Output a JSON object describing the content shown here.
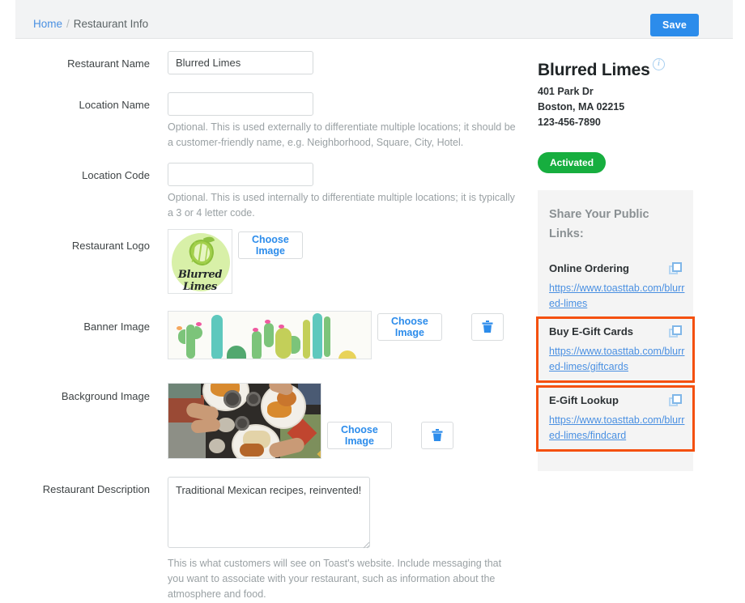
{
  "header": {
    "breadcrumb_home": "Home",
    "breadcrumb_sep": "/",
    "breadcrumb_current": "Restaurant Info",
    "save_label": "Save",
    "accent_blue": "#2c8ceb",
    "bar_bg": "#f2f3f4"
  },
  "form": {
    "restaurant_name": {
      "label": "Restaurant Name",
      "value": "Blurred Limes",
      "placeholder": ""
    },
    "location_name": {
      "label": "Location Name",
      "value": "",
      "placeholder": "",
      "helper": "Optional. This is used externally to differentiate multiple locations; it should be a customer-friendly name, e.g. Neighborhood, Square, City, Hotel."
    },
    "location_code": {
      "label": "Location Code",
      "value": "",
      "placeholder": "",
      "helper": "Optional. This is used internally to differentiate multiple locations; it is typically a 3 or 4 letter code."
    },
    "restaurant_logo": {
      "label": "Restaurant Logo",
      "choose_label": "Choose Image",
      "image_alt": "Blurred Limes lime logo",
      "logo_text": "Blurred Limes"
    },
    "banner_image": {
      "label": "Banner Image",
      "choose_label": "Choose Image",
      "delete_icon": "trash-icon",
      "image_alt": "Watercolor cactus banner"
    },
    "background_image": {
      "label": "Background Image",
      "choose_label": "Choose Image",
      "delete_icon": "trash-icon",
      "image_alt": "Overhead photo of people sharing a meal"
    },
    "restaurant_description": {
      "label": "Restaurant Description",
      "value": "Traditional Mexican recipes, reinvented!",
      "placeholder": "",
      "helper": "This is what customers will see on Toast's website. Include messaging that you want to associate with your restaurant, such as information about the atmosphere and food."
    }
  },
  "info_panel": {
    "restaurant_title": "Blurred Limes",
    "info_icon": "info-circle-icon",
    "address_line1": "401 Park Dr",
    "address_line2": "Boston, MA 02215",
    "phone": "123-456-7890",
    "status_badge": "Activated",
    "status_color": "#17ae3f",
    "share_title": "Share Your Public Links:",
    "highlight_color": "#f4500f",
    "links": [
      {
        "name": "Online Ordering",
        "url": "https://www.toasttab.com/blurred-limes",
        "copy_icon": "copy-icon",
        "highlighted": false
      },
      {
        "name": "Buy E-Gift Cards",
        "url": "https://www.toasttab.com/blurred-limes/giftcards",
        "copy_icon": "copy-icon",
        "highlighted": true
      },
      {
        "name": "E-Gift Lookup",
        "url": "https://www.toasttab.com/blurred-limes/findcard",
        "copy_icon": "copy-icon",
        "highlighted": true
      }
    ]
  }
}
